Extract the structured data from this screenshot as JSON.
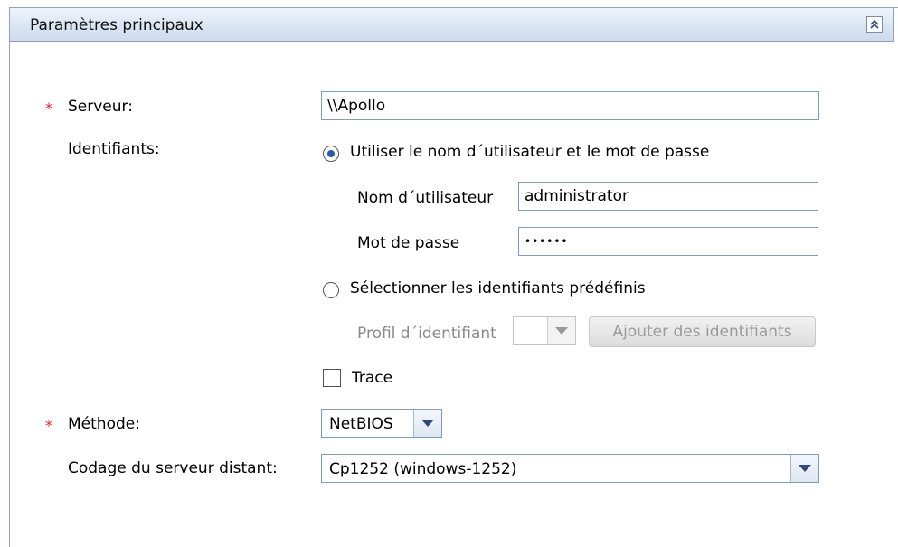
{
  "panel": {
    "title": "Paramètres principaux",
    "collapse_icon": "double-chevron-up-icon"
  },
  "form": {
    "required_mark": "*",
    "server": {
      "label": "Serveur:",
      "value": "\\\\Apollo"
    },
    "credentials": {
      "label": "Identifiants:",
      "option_user_pass": "Utiliser le nom d´utilisateur et le mot de passe",
      "username_label": "Nom d´utilisateur",
      "username_value": "administrator",
      "password_label": "Mot de passe",
      "password_value": "••••••",
      "option_predefined": "Sélectionner les identifiants prédéfinis",
      "profile_label": "Profil d´identifiant",
      "profile_value": "",
      "add_button": "Ajouter des identifiants",
      "selected_option": "user_pass"
    },
    "trace": {
      "label": "Trace",
      "checked": false
    },
    "method": {
      "label": "Méthode:",
      "value": "NetBIOS"
    },
    "encoding": {
      "label": "Codage du serveur distant:",
      "value": "Cp1252 (windows-1252)"
    }
  }
}
